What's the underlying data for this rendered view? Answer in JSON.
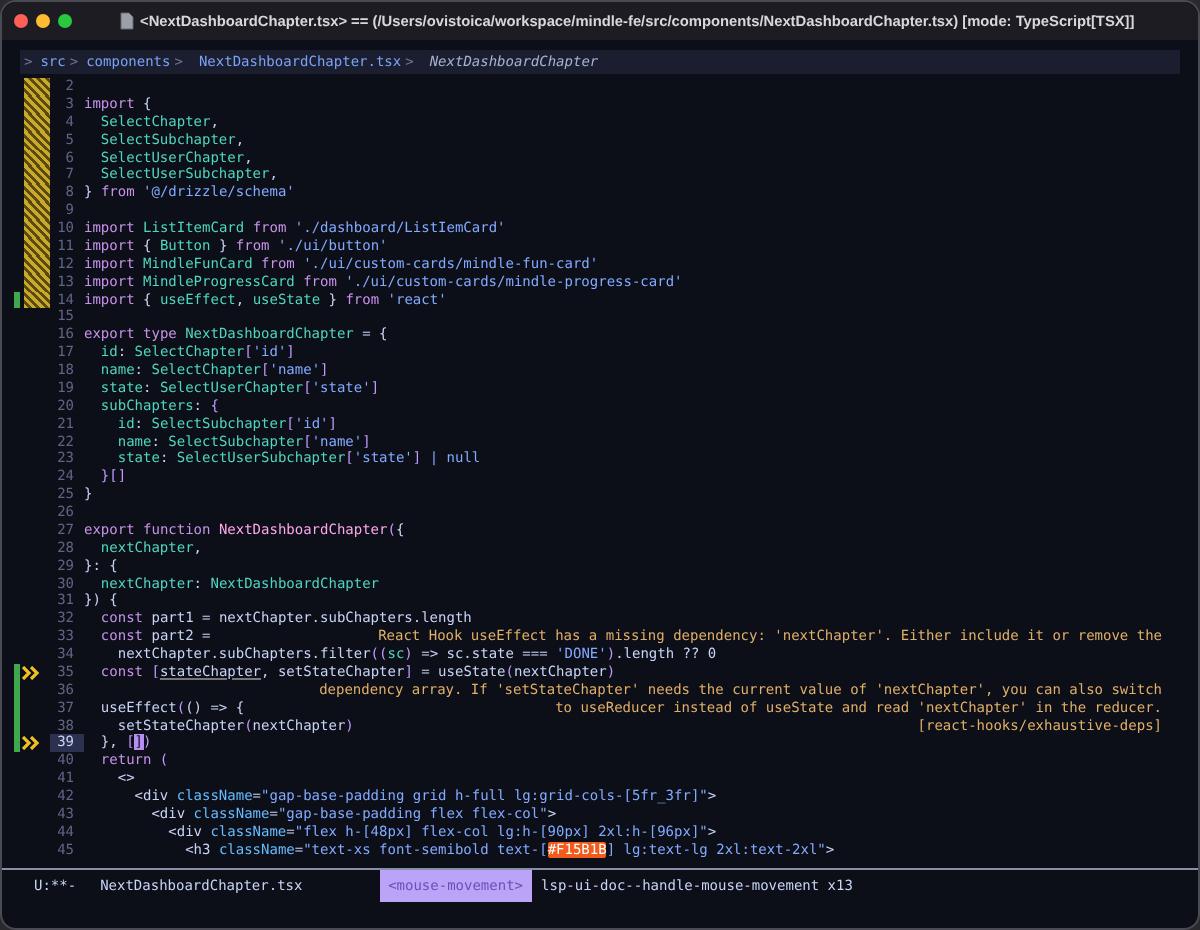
{
  "window": {
    "title": "<NextDashboardChapter.tsx> == (/Users/ovistoica/workspace/mindle-fe/src/components/NextDashboardChapter.tsx) [mode: TypeScript[TSX]]"
  },
  "breadcrumb": [
    {
      "separator": ">",
      "label": "src",
      "kind": "dir"
    },
    {
      "separator": ">",
      "label": "components",
      "kind": "dir"
    },
    {
      "separator": ">",
      "label": "NextDashboardChapter.tsx",
      "kind": "file"
    },
    {
      "separator": ">",
      "label": "NextDashboardChapter",
      "kind": "symbol"
    }
  ],
  "lines": [
    {
      "number": "2",
      "change": true,
      "flag": false,
      "warning": false,
      "current": false
    },
    {
      "number": "3",
      "change": true,
      "flag": false,
      "warning": false,
      "current": false,
      "tokens": [
        {
          "text": "import",
          "kind": "kw"
        },
        {
          "text": " {",
          "kind": "plain"
        }
      ]
    },
    {
      "number": "4",
      "change": true,
      "flag": false,
      "warning": false,
      "current": false,
      "tokens": [
        {
          "text": "  SelectChapter",
          "kind": "type"
        },
        {
          "text": ",",
          "kind": "plain"
        }
      ]
    },
    {
      "number": "5",
      "change": true,
      "flag": false,
      "warning": false,
      "current": false,
      "tokens": [
        {
          "text": "  SelectSubchapter",
          "kind": "type"
        },
        {
          "text": ",",
          "kind": "plain"
        }
      ]
    },
    {
      "number": "6",
      "change": true,
      "flag": false,
      "warning": false,
      "current": false,
      "tokens": [
        {
          "text": "  SelectUserChapter",
          "kind": "type"
        },
        {
          "text": ",",
          "kind": "plain"
        }
      ]
    },
    {
      "number": "7",
      "change": true,
      "flag": false,
      "warning": false,
      "current": false,
      "tokens": [
        {
          "text": "  SelectUserSubchapter",
          "kind": "type"
        },
        {
          "text": ",",
          "kind": "plain"
        }
      ]
    },
    {
      "number": "8",
      "change": true,
      "flag": false,
      "warning": false,
      "current": false,
      "tokens": [
        {
          "text": "} ",
          "kind": "plain"
        },
        {
          "text": "from",
          "kind": "kw"
        },
        {
          "text": " '@/drizzle/schema'",
          "kind": "str"
        }
      ]
    },
    {
      "number": "9",
      "change": true,
      "flag": false,
      "warning": false,
      "current": false
    },
    {
      "number": "10",
      "change": true,
      "flag": false,
      "warning": false,
      "current": false,
      "tokens": [
        {
          "text": "import",
          "kind": "kw"
        },
        {
          "text": " ListItemCard ",
          "kind": "type"
        },
        {
          "text": "from",
          "kind": "kw"
        },
        {
          "text": " './dashboard/ListIemCard'",
          "kind": "str"
        }
      ]
    },
    {
      "number": "11",
      "change": true,
      "flag": false,
      "warning": false,
      "current": false,
      "tokens": [
        {
          "text": "import",
          "kind": "kw"
        },
        {
          "text": " { ",
          "kind": "plain"
        },
        {
          "text": "Button",
          "kind": "type"
        },
        {
          "text": " } ",
          "kind": "plain"
        },
        {
          "text": "from",
          "kind": "kw"
        },
        {
          "text": " './ui/button'",
          "kind": "str"
        }
      ]
    },
    {
      "number": "12",
      "change": true,
      "flag": false,
      "warning": false,
      "current": false,
      "tokens": [
        {
          "text": "import",
          "kind": "kw"
        },
        {
          "text": " MindleFunCard ",
          "kind": "type"
        },
        {
          "text": "from",
          "kind": "kw"
        },
        {
          "text": " './ui/custom-cards/mindle-fun-card'",
          "kind": "str"
        }
      ]
    },
    {
      "number": "13",
      "change": true,
      "flag": false,
      "warning": false,
      "current": false,
      "tokens": [
        {
          "text": "import",
          "kind": "kw"
        },
        {
          "text": " MindleProgressCard ",
          "kind": "type"
        },
        {
          "text": "from",
          "kind": "kw"
        },
        {
          "text": " './ui/custom-cards/mindle-progress-card'",
          "kind": "str"
        }
      ]
    },
    {
      "number": "14",
      "change": true,
      "flag": true,
      "warning": false,
      "current": false,
      "tokens": [
        {
          "text": "import",
          "kind": "kw"
        },
        {
          "text": " { ",
          "kind": "plain"
        },
        {
          "text": "useEffect",
          "kind": "type"
        },
        {
          "text": ", ",
          "kind": "plain"
        },
        {
          "text": "useState",
          "kind": "type"
        },
        {
          "text": " } ",
          "kind": "plain"
        },
        {
          "text": "from",
          "kind": "kw"
        },
        {
          "text": " 'react'",
          "kind": "str"
        }
      ]
    },
    {
      "number": "15",
      "change": false,
      "flag": false,
      "warning": false,
      "current": false
    },
    {
      "number": "16",
      "change": false,
      "flag": false,
      "warning": false,
      "current": false,
      "tokens": [
        {
          "text": "export",
          "kind": "kw"
        },
        {
          "text": " type",
          "kind": "kw"
        },
        {
          "text": " NextDashboardChapter",
          "kind": "type"
        },
        {
          "text": " = {",
          "kind": "plain"
        }
      ]
    },
    {
      "number": "17",
      "change": false,
      "flag": false,
      "warning": false,
      "current": false,
      "tokens": [
        {
          "text": "  id",
          "kind": "prop"
        },
        {
          "text": ": ",
          "kind": "plain"
        },
        {
          "text": "SelectChapter",
          "kind": "type"
        },
        {
          "text": "[",
          "kind": "brace"
        },
        {
          "text": "'id'",
          "kind": "str"
        },
        {
          "text": "]",
          "kind": "brace"
        }
      ]
    },
    {
      "number": "18",
      "change": false,
      "flag": false,
      "warning": false,
      "current": false,
      "tokens": [
        {
          "text": "  name",
          "kind": "prop"
        },
        {
          "text": ": ",
          "kind": "plain"
        },
        {
          "text": "SelectChapter",
          "kind": "type"
        },
        {
          "text": "[",
          "kind": "brace"
        },
        {
          "text": "'name'",
          "kind": "str"
        },
        {
          "text": "]",
          "kind": "brace"
        }
      ]
    },
    {
      "number": "19",
      "change": false,
      "flag": false,
      "warning": false,
      "current": false,
      "tokens": [
        {
          "text": "  state",
          "kind": "prop"
        },
        {
          "text": ": ",
          "kind": "plain"
        },
        {
          "text": "SelectUserChapter",
          "kind": "type"
        },
        {
          "text": "[",
          "kind": "brace"
        },
        {
          "text": "'state'",
          "kind": "str"
        },
        {
          "text": "]",
          "kind": "brace"
        }
      ]
    },
    {
      "number": "20",
      "change": false,
      "flag": false,
      "warning": false,
      "current": false,
      "tokens": [
        {
          "text": "  subChapters",
          "kind": "prop"
        },
        {
          "text": ": ",
          "kind": "plain"
        },
        {
          "text": "{",
          "kind": "brace"
        }
      ]
    },
    {
      "number": "21",
      "change": false,
      "flag": false,
      "warning": false,
      "current": false,
      "tokens": [
        {
          "text": "    id",
          "kind": "prop"
        },
        {
          "text": ": ",
          "kind": "plain"
        },
        {
          "text": "SelectSubchapter",
          "kind": "type"
        },
        {
          "text": "[",
          "kind": "brace"
        },
        {
          "text": "'id'",
          "kind": "str"
        },
        {
          "text": "]",
          "kind": "brace"
        }
      ]
    },
    {
      "number": "22",
      "change": false,
      "flag": false,
      "warning": false,
      "current": false,
      "tokens": [
        {
          "text": "    name",
          "kind": "prop"
        },
        {
          "text": ": ",
          "kind": "plain"
        },
        {
          "text": "SelectSubchapter",
          "kind": "type"
        },
        {
          "text": "[",
          "kind": "brace"
        },
        {
          "text": "'name'",
          "kind": "str"
        },
        {
          "text": "]",
          "kind": "brace"
        }
      ]
    },
    {
      "number": "23",
      "change": false,
      "flag": false,
      "warning": false,
      "current": false,
      "tokens": [
        {
          "text": "    state",
          "kind": "prop"
        },
        {
          "text": ": ",
          "kind": "plain"
        },
        {
          "text": "SelectUserSubchapter",
          "kind": "type"
        },
        {
          "text": "[",
          "kind": "brace"
        },
        {
          "text": "'state'",
          "kind": "str"
        },
        {
          "text": "]",
          "kind": "brace"
        },
        {
          "text": " | null",
          "kind": "lit"
        }
      ]
    },
    {
      "number": "24",
      "change": false,
      "flag": false,
      "warning": false,
      "current": false,
      "tokens": [
        {
          "text": "  }[]",
          "kind": "brace"
        }
      ]
    },
    {
      "number": "25",
      "change": false,
      "flag": false,
      "warning": false,
      "current": false,
      "tokens": [
        {
          "text": "}",
          "kind": "plain"
        }
      ]
    },
    {
      "number": "26",
      "change": false,
      "flag": false,
      "warning": false,
      "current": false
    },
    {
      "number": "27",
      "change": false,
      "flag": false,
      "warning": false,
      "current": false,
      "tokens": [
        {
          "text": "export",
          "kind": "kw"
        },
        {
          "text": " function",
          "kind": "kw"
        },
        {
          "text": " NextDashboardChapter",
          "kind": "fn"
        },
        {
          "text": "(",
          "kind": "brace"
        },
        {
          "text": "{",
          "kind": "plain"
        }
      ]
    },
    {
      "number": "28",
      "change": false,
      "flag": false,
      "warning": false,
      "current": false,
      "tokens": [
        {
          "text": "  nextChapter",
          "kind": "prop"
        },
        {
          "text": ",",
          "kind": "plain"
        }
      ]
    },
    {
      "number": "29",
      "change": false,
      "flag": false,
      "warning": false,
      "current": false,
      "tokens": [
        {
          "text": "}: {",
          "kind": "plain"
        }
      ]
    },
    {
      "number": "30",
      "change": false,
      "flag": false,
      "warning": false,
      "current": false,
      "tokens": [
        {
          "text": "  nextChapter",
          "kind": "prop"
        },
        {
          "text": ": ",
          "kind": "plain"
        },
        {
          "text": "NextDashboardChapter",
          "kind": "type"
        }
      ]
    },
    {
      "number": "31",
      "change": false,
      "flag": false,
      "warning": false,
      "current": false,
      "tokens": [
        {
          "text": "}) {",
          "kind": "plain"
        }
      ]
    },
    {
      "number": "32",
      "change": false,
      "flag": false,
      "warning": false,
      "current": false,
      "tokens": [
        {
          "text": "  const",
          "kind": "kw"
        },
        {
          "text": " part1 = nextChapter.subChapters.length",
          "kind": "plain"
        }
      ]
    },
    {
      "number": "33",
      "change": false,
      "flag": false,
      "warning": false,
      "current": false,
      "tokens": [
        {
          "text": "  const",
          "kind": "kw"
        },
        {
          "text": " part2 =",
          "kind": "plain"
        }
      ],
      "message": "React Hook useEffect has a missing dependency: 'nextChapter'. Either include it or remove the"
    },
    {
      "number": "34",
      "change": false,
      "flag": false,
      "warning": false,
      "current": false,
      "tokens": [
        {
          "text": "    nextChapter.subChapters.filter",
          "kind": "plain"
        },
        {
          "text": "((",
          "kind": "brace"
        },
        {
          "text": "sc",
          "kind": "prop"
        },
        {
          "text": ")",
          "kind": "brace"
        },
        {
          "text": " => sc.state === ",
          "kind": "plain"
        },
        {
          "text": "'DONE'",
          "kind": "str"
        },
        {
          "text": ")",
          "kind": "brace"
        },
        {
          "text": ".length ?? 0",
          "kind": "plain"
        }
      ]
    },
    {
      "number": "35",
      "change": false,
      "flag": true,
      "warning": true,
      "current": false,
      "tokens": [
        {
          "text": "  const",
          "kind": "kw"
        },
        {
          "text": " [",
          "kind": "brace"
        },
        {
          "text": "stateChapter",
          "kind": "unused"
        },
        {
          "text": ", setStateChapter",
          "kind": "plain"
        },
        {
          "text": "]",
          "kind": "brace"
        },
        {
          "text": " = useState",
          "kind": "plain"
        },
        {
          "text": "(",
          "kind": "brace"
        },
        {
          "text": "nextChapter",
          "kind": "plain"
        },
        {
          "text": ")",
          "kind": "brace"
        }
      ]
    },
    {
      "number": "36",
      "change": false,
      "flag": true,
      "warning": false,
      "current": false,
      "message": "dependency array. If 'setStateChapter' needs the current value of 'nextChapter', you can also switch"
    },
    {
      "number": "37",
      "change": false,
      "flag": true,
      "warning": false,
      "current": false,
      "tokens": [
        {
          "text": "  useEffect",
          "kind": "plain"
        },
        {
          "text": "(",
          "kind": "brace"
        },
        {
          "text": "() => {",
          "kind": "plain"
        }
      ],
      "message": "to useReducer instead of useState and read 'nextChapter' in the reducer."
    },
    {
      "number": "38",
      "change": false,
      "flag": true,
      "warning": false,
      "current": false,
      "tokens": [
        {
          "text": "    setStateChapter",
          "kind": "plain"
        },
        {
          "text": "(",
          "kind": "brace"
        },
        {
          "text": "nextChapter",
          "kind": "plain"
        },
        {
          "text": ")",
          "kind": "brace"
        }
      ],
      "message": "[react-hooks/exhaustive-deps]"
    },
    {
      "number": "39",
      "change": false,
      "flag": true,
      "warning": true,
      "current": true,
      "tokens": [
        {
          "text": "  }, ",
          "kind": "plain"
        },
        {
          "text": "[",
          "kind": "brace"
        },
        {
          "text": "]",
          "kind": "cursor"
        },
        {
          "text": ")",
          "kind": "brace"
        }
      ]
    },
    {
      "number": "40",
      "change": false,
      "flag": false,
      "warning": false,
      "current": false,
      "tokens": [
        {
          "text": "  return",
          "kind": "kw"
        },
        {
          "text": " (",
          "kind": "brace"
        }
      ]
    },
    {
      "number": "41",
      "change": false,
      "flag": false,
      "warning": false,
      "current": false,
      "tokens": [
        {
          "text": "    <>",
          "kind": "plain"
        }
      ]
    },
    {
      "number": "42",
      "change": false,
      "flag": false,
      "warning": false,
      "current": false,
      "tokens": [
        {
          "text": "      <div ",
          "kind": "plain"
        },
        {
          "text": "className",
          "kind": "attr"
        },
        {
          "text": "=",
          "kind": "plain"
        },
        {
          "text": "\"gap-base-padding grid h-full lg:grid-cols-[5fr_3fr]\"",
          "kind": "str"
        },
        {
          "text": ">",
          "kind": "plain"
        }
      ]
    },
    {
      "number": "43",
      "change": false,
      "flag": false,
      "warning": false,
      "current": false,
      "tokens": [
        {
          "text": "        <div ",
          "kind": "plain"
        },
        {
          "text": "className",
          "kind": "attr"
        },
        {
          "text": "=",
          "kind": "plain"
        },
        {
          "text": "\"gap-base-padding flex flex-col\"",
          "kind": "str"
        },
        {
          "text": ">",
          "kind": "plain"
        }
      ]
    },
    {
      "number": "44",
      "change": false,
      "flag": false,
      "warning": false,
      "current": false,
      "tokens": [
        {
          "text": "          <div ",
          "kind": "plain"
        },
        {
          "text": "className",
          "kind": "attr"
        },
        {
          "text": "=",
          "kind": "plain"
        },
        {
          "text": "\"flex h-[48px] flex-col lg:h-[90px] 2xl:h-[96px]\"",
          "kind": "str"
        },
        {
          "text": ">",
          "kind": "plain"
        }
      ]
    },
    {
      "number": "45",
      "change": false,
      "flag": false,
      "warning": false,
      "current": false,
      "tokens": [
        {
          "text": "            <h3 ",
          "kind": "plain"
        },
        {
          "text": "className",
          "kind": "attr"
        },
        {
          "text": "=",
          "kind": "plain"
        },
        {
          "text": "\"text-xs font-semibold text-[",
          "kind": "str"
        },
        {
          "text": "#F15B1B",
          "kind": "swatch"
        },
        {
          "text": "] lg:text-lg 2xl:text-2xl\"",
          "kind": "str"
        },
        {
          "text": ">",
          "kind": "plain"
        }
      ]
    }
  ],
  "status_bar": {
    "state": "U:**-",
    "file": "NextDashboardChapter.tsx",
    "key": "<mouse-movement>",
    "command": "lsp-ui-doc--handle-mouse-movement x13"
  }
}
